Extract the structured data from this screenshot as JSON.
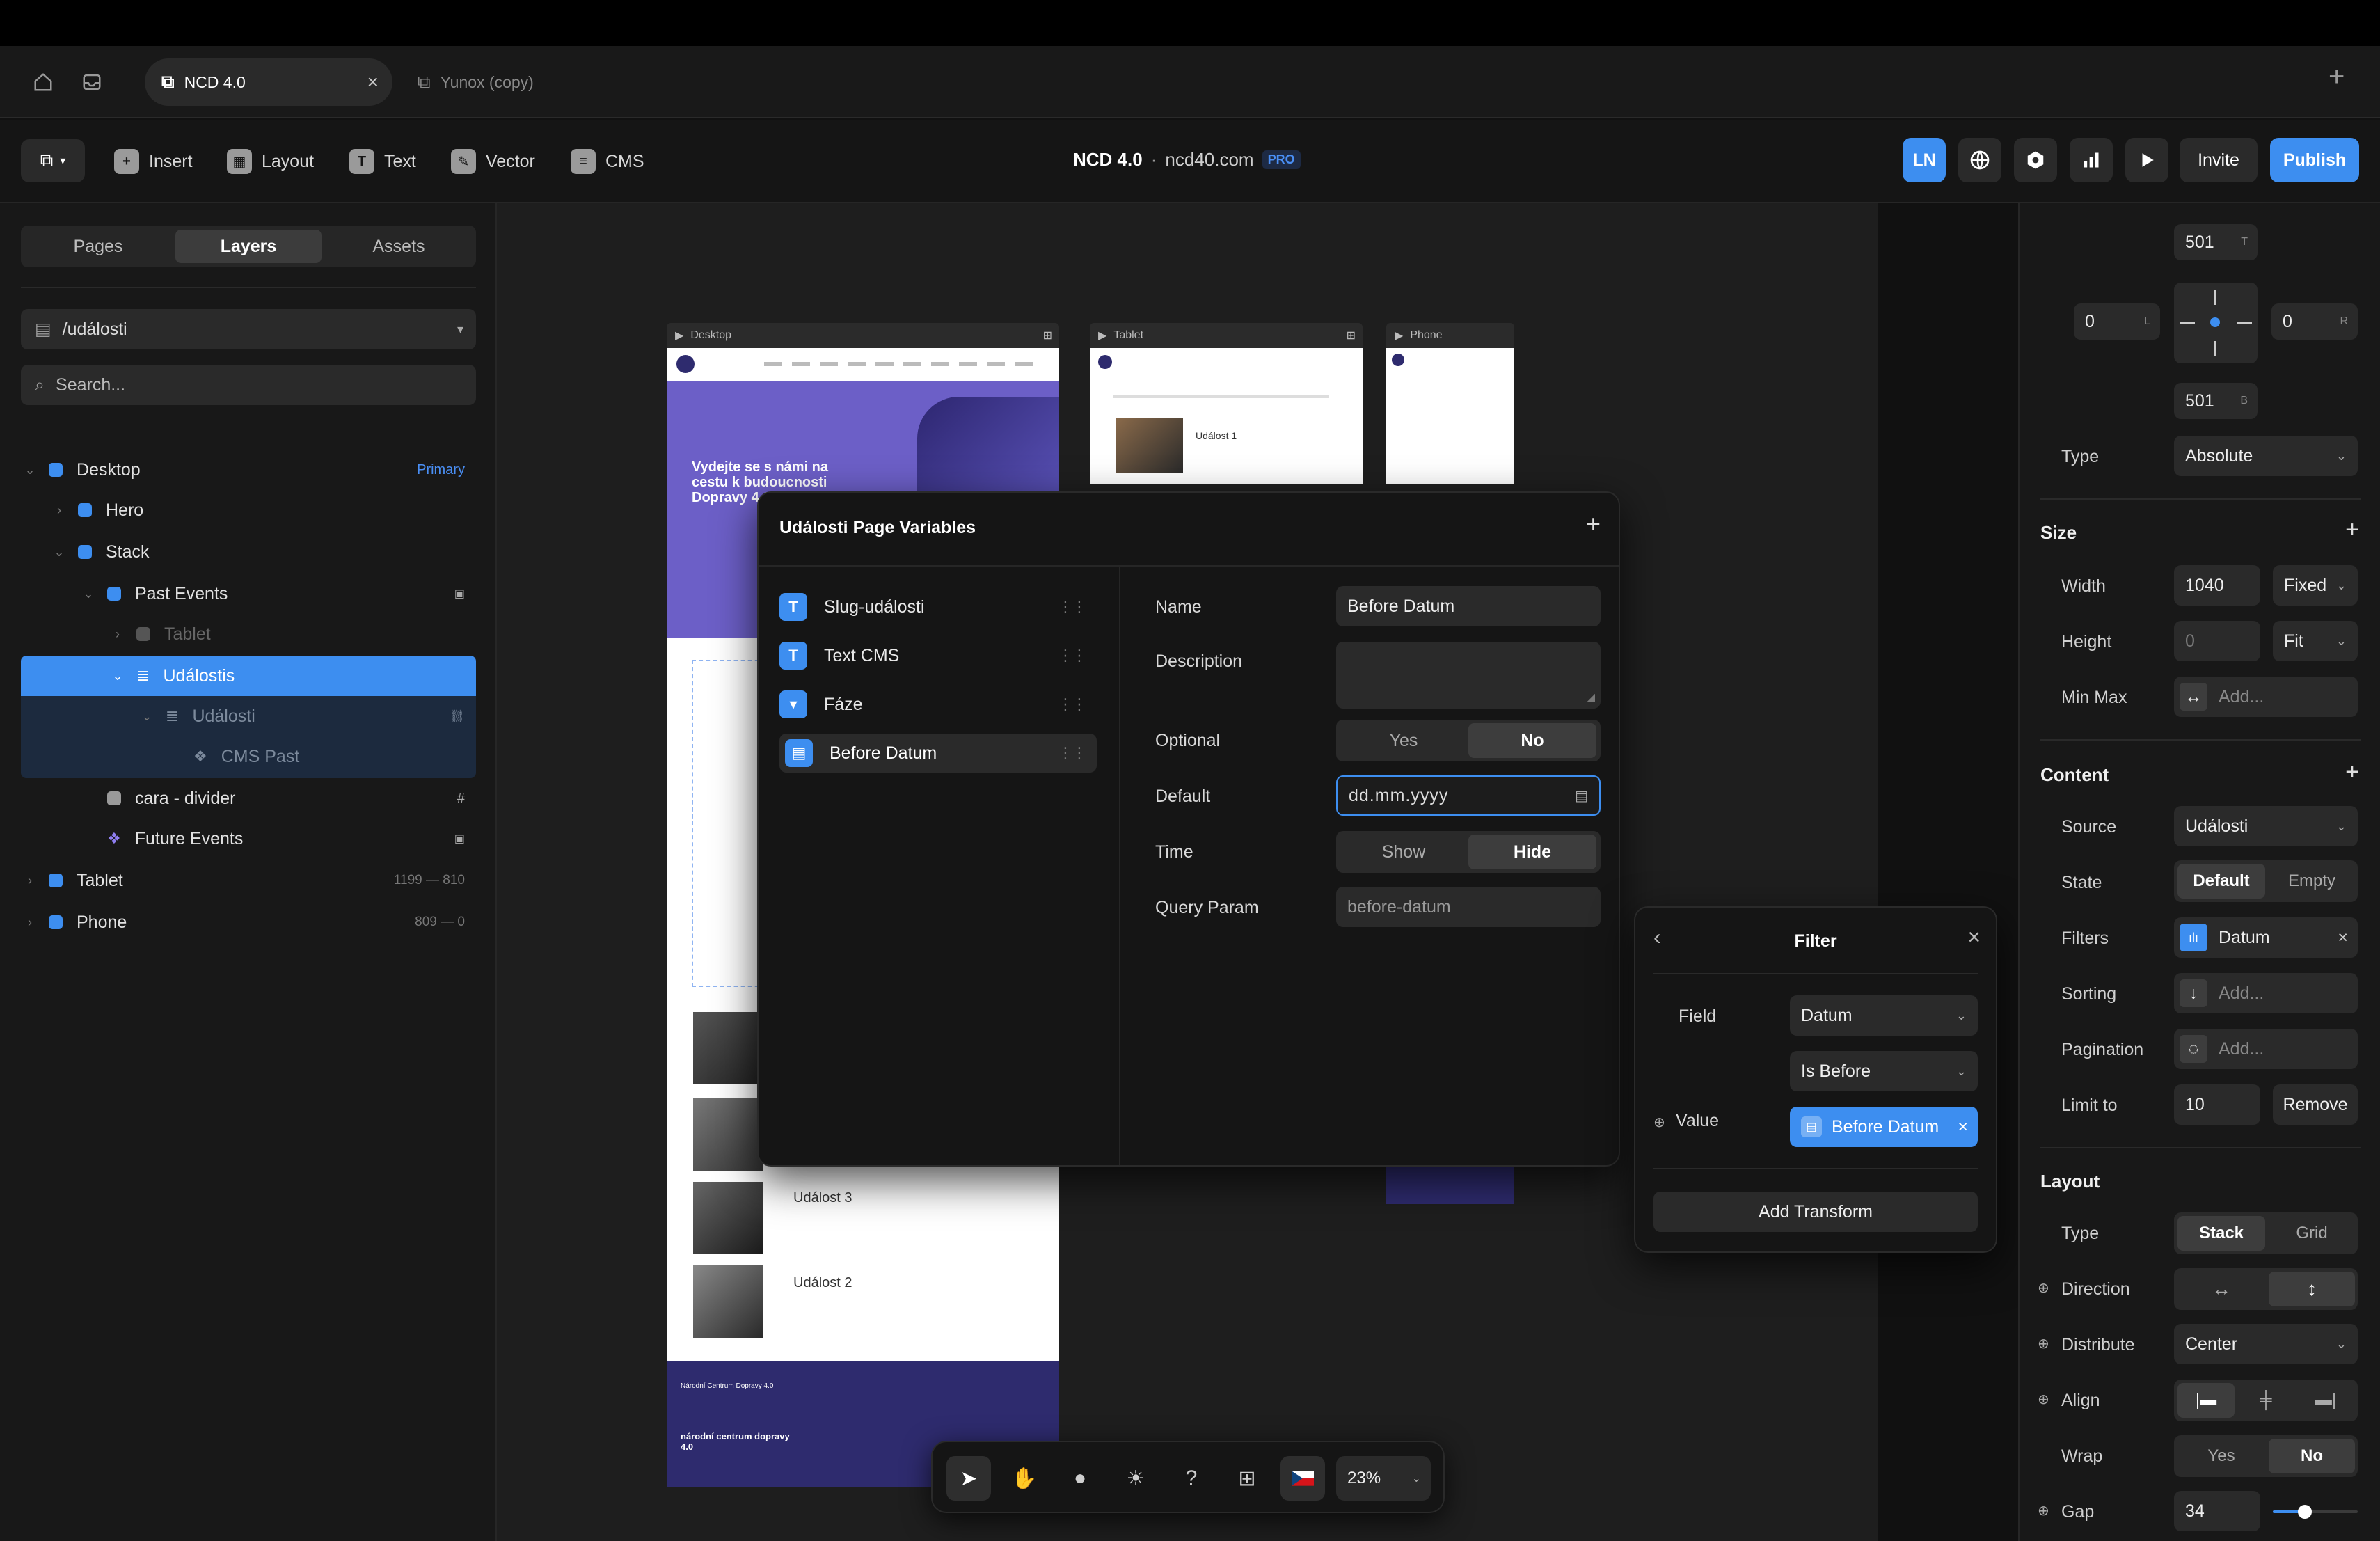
{
  "tabs": [
    {
      "label": "NCD 4.0",
      "close": "×"
    },
    {
      "label": "Yunox (copy)"
    }
  ],
  "tabbar": {
    "new_tab": "+"
  },
  "toolbar": {
    "insert": "Insert",
    "layout": "Layout",
    "text": "Text",
    "vector": "Vector",
    "cms": "CMS",
    "project_name": "NCD 4.0",
    "separator": "·",
    "domain": "ncd40.com",
    "plan_badge": "PRO",
    "avatar_initials": "LN",
    "invite": "Invite",
    "publish": "Publish"
  },
  "left": {
    "tabs": [
      "Pages",
      "Layers",
      "Assets"
    ],
    "page_path": "/události",
    "search_placeholder": "Search...",
    "layers": [
      {
        "label": "Desktop",
        "badge": "Primary"
      },
      {
        "label": "Hero"
      },
      {
        "label": "Stack"
      },
      {
        "label": "Past Events"
      },
      {
        "label": "Tablet"
      },
      {
        "label": "Událostis"
      },
      {
        "label": "Události"
      },
      {
        "label": "CMS Past"
      },
      {
        "label": "cara - divider",
        "badge": "#"
      },
      {
        "label": "Future Events"
      },
      {
        "label": "Tablet",
        "badge": "1199 — 810"
      },
      {
        "label": "Phone",
        "badge": "809 — 0"
      }
    ]
  },
  "canvas": {
    "frames": [
      "Desktop",
      "Tablet",
      "Phone"
    ],
    "desktop": {
      "hero_title": "Vydejte se s námi na cestu k budoucnosti Dopravy 4.0",
      "events": [
        "Událost 3",
        "Událost 2"
      ],
      "footer_title": "Národní Centrum Dopravy 4.0",
      "footer_logo": "národní centrum dopravy 4.0"
    },
    "tablet": {
      "event": "Událost 1"
    }
  },
  "modal": {
    "title": "Události Page Variables",
    "add": "+",
    "variables": [
      {
        "label": "Slug-události",
        "icon": "T",
        "color": "#3d8ef0"
      },
      {
        "label": "Text CMS",
        "icon": "T",
        "color": "#3d8ef0"
      },
      {
        "label": "Fáze",
        "icon": "▾",
        "color": "#3d8ef0"
      },
      {
        "label": "Before Datum",
        "icon": "▤",
        "color": "#3d8ef0"
      }
    ],
    "props": {
      "name_label": "Name",
      "name_value": "Before Datum",
      "description_label": "Description",
      "optional_label": "Optional",
      "optional_yes": "Yes",
      "optional_no": "No",
      "default_label": "Default",
      "default_placeholder": "dd.mm.yyyy",
      "time_label": "Time",
      "time_show": "Show",
      "time_hide": "Hide",
      "query_label": "Query Param",
      "query_placeholder": "before-datum"
    }
  },
  "filter": {
    "title": "Filter",
    "back": "‹",
    "close": "×",
    "field_label": "Field",
    "field_value": "Datum",
    "operator_value": "Is Before",
    "value_label": "Value",
    "value_token": "Before Datum",
    "add_transform": "Add Transform"
  },
  "right": {
    "pos": {
      "top": "501",
      "top_tag": "T",
      "left": "0",
      "left_tag": "L",
      "right": "0",
      "right_tag": "R",
      "bottom": "501",
      "bottom_tag": "B"
    },
    "type_label": "Type",
    "type_value": "Absolute",
    "size_title": "Size",
    "width_label": "Width",
    "width_value": "1040",
    "width_mode": "Fixed",
    "height_label": "Height",
    "height_placeholder": "0",
    "height_mode": "Fit",
    "minmax_label": "Min Max",
    "minmax_add": "Add...",
    "content_title": "Content",
    "source_label": "Source",
    "source_value": "Události",
    "state_label": "State",
    "state_default": "Default",
    "state_empty": "Empty",
    "filters_label": "Filters",
    "filters_value": "Datum",
    "sorting_label": "Sorting",
    "sorting_add": "Add...",
    "pagination_label": "Pagination",
    "pagination_add": "Add...",
    "limit_label": "Limit to",
    "limit_value": "10",
    "limit_remove": "Remove",
    "layout_title": "Layout",
    "ltype_label": "Type",
    "ltype_stack": "Stack",
    "ltype_grid": "Grid",
    "direction_label": "Direction",
    "distribute_label": "Distribute",
    "distribute_value": "Center",
    "align_label": "Align",
    "wrap_label": "Wrap",
    "wrap_yes": "Yes",
    "wrap_no": "No",
    "gap_label": "Gap",
    "gap_value": "34"
  },
  "bottombar": {
    "zoom": "23%"
  },
  "colors": {
    "accent": "#3d8ef0",
    "selection": "#4a9cf5",
    "hero": "#6c5fc7",
    "footer": "#2e2b6e"
  }
}
